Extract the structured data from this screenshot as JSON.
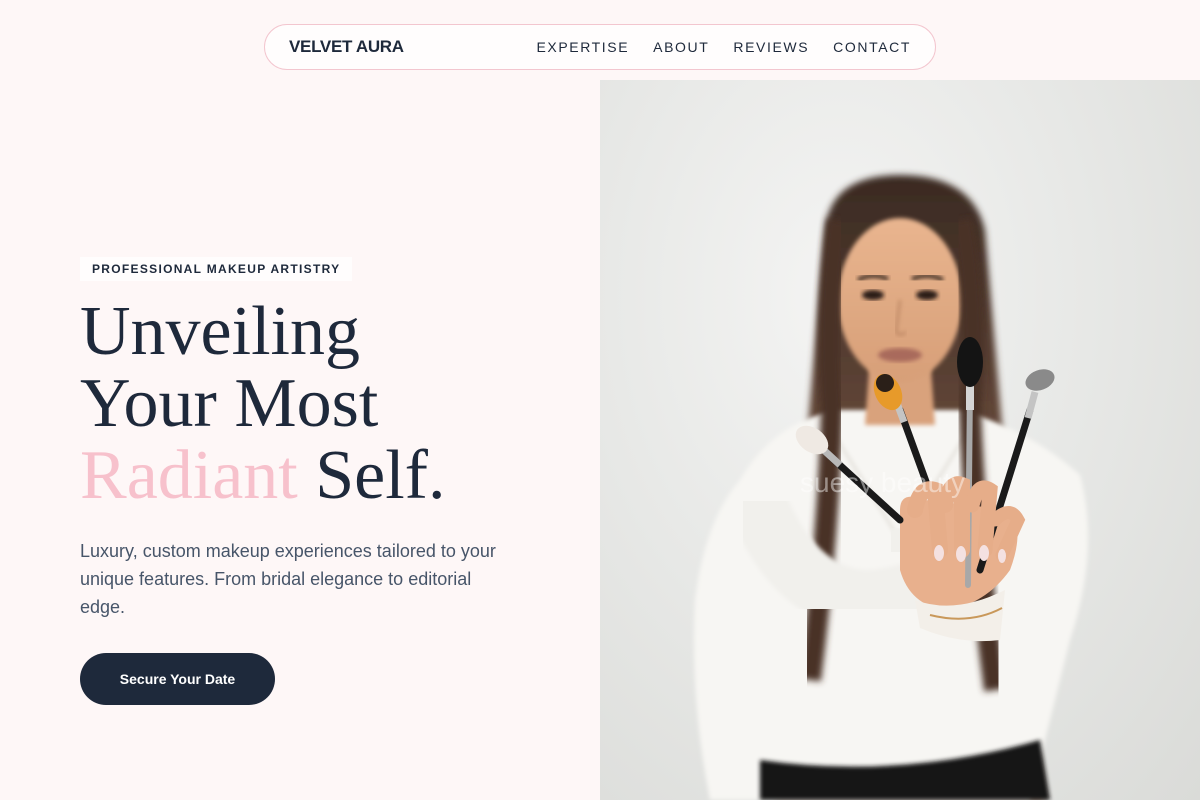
{
  "nav": {
    "brand": "VELVET AURA",
    "links": [
      "EXPERTISE",
      "ABOUT",
      "REVIEWS",
      "CONTACT"
    ]
  },
  "hero": {
    "eyebrow": "PROFESSIONAL MAKEUP ARTISTRY",
    "headline_line1": "Unveiling",
    "headline_line2": "Your Most",
    "headline_accent": "Radiant",
    "headline_end": " Self.",
    "lede": "Luxury, custom makeup experiences tailored to your unique features. From bridal elegance to editorial edge.",
    "cta_label": "Secure Your Date",
    "photo_watermark": "suesy beauty"
  },
  "colors": {
    "background": "#fef7f7",
    "ink": "#1e293b",
    "accent_pink": "#f7c1cc",
    "nav_border": "#f3c6cf"
  }
}
